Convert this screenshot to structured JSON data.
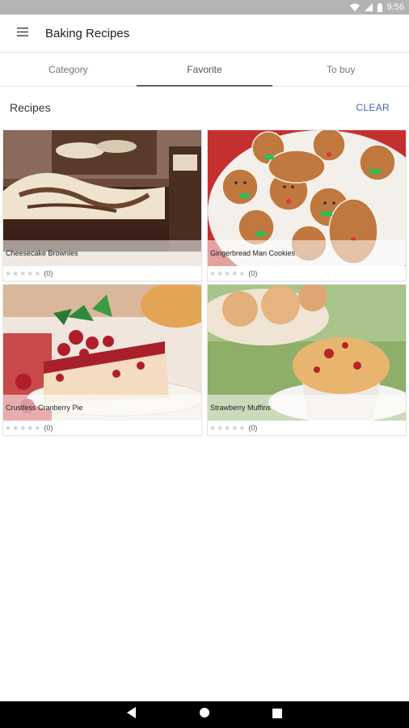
{
  "status": {
    "time": "9:56"
  },
  "app": {
    "title": "Baking Recipes"
  },
  "tabs": [
    {
      "label": "Category",
      "active": false
    },
    {
      "label": "Favorite",
      "active": true
    },
    {
      "label": "To buy",
      "active": false
    }
  ],
  "section": {
    "title": "Recipes",
    "clear_label": "CLEAR"
  },
  "recipes": [
    {
      "name": "Cheesecake Brownies",
      "rating": 0,
      "count": "(0)"
    },
    {
      "name": "Gingerbread Man Cookies",
      "rating": 0,
      "count": "(0)"
    },
    {
      "name": "Crustless Cranberry Pie",
      "rating": 0,
      "count": "(0)"
    },
    {
      "name": "Strawberry Muffins",
      "rating": 0,
      "count": "(0)"
    }
  ],
  "colors": {
    "accent": "#4466bb",
    "tab_indicator": "#6d5a58",
    "status_bar": "#b3b3b3"
  },
  "icons": [
    "wifi-icon",
    "signal-icon",
    "battery-icon",
    "menu-icon",
    "back-icon",
    "home-icon",
    "recents-icon",
    "star-icon"
  ]
}
